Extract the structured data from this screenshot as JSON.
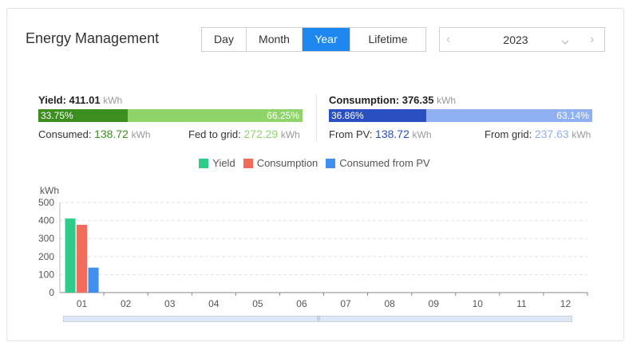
{
  "header": {
    "title": "Energy Management"
  },
  "period_tabs": [
    {
      "label": "Day",
      "active": false
    },
    {
      "label": "Month",
      "active": false
    },
    {
      "label": "Year",
      "active": true
    },
    {
      "label": "Lifetime",
      "active": false
    }
  ],
  "year_picker": {
    "value": "2023",
    "prev_icon": "chevron-left-icon",
    "next_icon": "chevron-right-icon",
    "dropdown_icon": "chevron-down-icon"
  },
  "yield": {
    "label": "Yield:",
    "value": "411.01",
    "unit": "kWh",
    "consumed_pct": "33.75%",
    "fed_pct": "66.25%",
    "consumed_pct_value": 33.75,
    "consumed_label": "Consumed:",
    "consumed_value": "138.72",
    "consumed_unit": "kWh",
    "fed_label": "Fed to grid:",
    "fed_value": "272.29",
    "fed_unit": "kWh",
    "colors": {
      "dark": "#3a8f1e",
      "light": "#8fd469",
      "consumed_text": "#3a8f1e",
      "fed_text": "#8fd469"
    }
  },
  "consumption": {
    "label": "Consumption:",
    "value": "376.35",
    "unit": "kWh",
    "pv_pct": "36.86%",
    "grid_pct": "63.14%",
    "pv_pct_value": 36.86,
    "pv_label": "From PV:",
    "pv_value": "138.72",
    "pv_unit": "kWh",
    "grid_label": "From grid:",
    "grid_value": "237.63",
    "grid_unit": "kWh",
    "colors": {
      "dark": "#2a4fc0",
      "light": "#8fb0f2",
      "pv_text": "#2a4fc0",
      "grid_text": "#8fb0f2"
    }
  },
  "legend": [
    {
      "label": "Yield",
      "color": "#2ecc8a"
    },
    {
      "label": "Consumption",
      "color": "#f26b5b"
    },
    {
      "label": "Consumed from PV",
      "color": "#3d8ff0"
    }
  ],
  "chart_data": {
    "type": "bar",
    "ylabel": "kWh",
    "ylim": [
      0,
      500
    ],
    "yticks": [
      0,
      100,
      200,
      300,
      400,
      500
    ],
    "categories": [
      "01",
      "02",
      "03",
      "04",
      "05",
      "06",
      "07",
      "08",
      "09",
      "10",
      "11",
      "12"
    ],
    "series": [
      {
        "name": "Yield",
        "color": "#2ecc8a",
        "values": [
          411.01,
          0,
          0,
          0,
          0,
          0,
          0,
          0,
          0,
          0,
          0,
          0
        ]
      },
      {
        "name": "Consumption",
        "color": "#f26b5b",
        "values": [
          376.35,
          0,
          0,
          0,
          0,
          0,
          0,
          0,
          0,
          0,
          0,
          0
        ]
      },
      {
        "name": "Consumed from PV",
        "color": "#3d8ff0",
        "values": [
          138.72,
          0,
          0,
          0,
          0,
          0,
          0,
          0,
          0,
          0,
          0,
          0
        ]
      }
    ],
    "grid": true,
    "legend_position": "top-center"
  }
}
